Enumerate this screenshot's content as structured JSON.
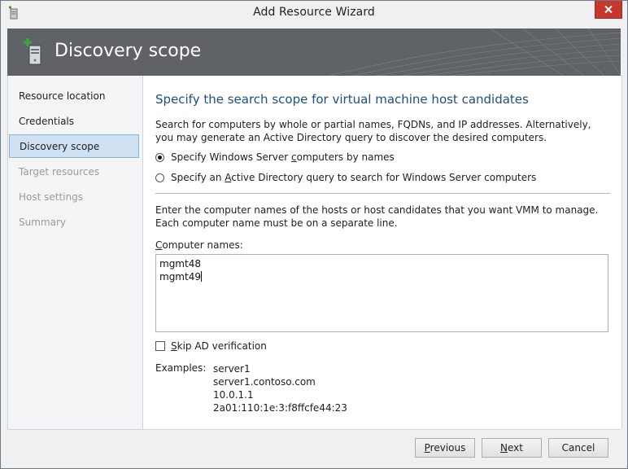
{
  "window": {
    "title": "Add Resource Wizard"
  },
  "banner": {
    "title": "Discovery scope"
  },
  "nav": {
    "items": [
      {
        "label": "Resource location",
        "state": "enabled"
      },
      {
        "label": "Credentials",
        "state": "enabled"
      },
      {
        "label": "Discovery scope",
        "state": "selected"
      },
      {
        "label": "Target resources",
        "state": "disabled"
      },
      {
        "label": "Host settings",
        "state": "disabled"
      },
      {
        "label": "Summary",
        "state": "disabled"
      }
    ]
  },
  "main": {
    "heading": "Specify the search scope for virtual machine host candidates",
    "description": "Search for computers by whole or partial names, FQDNs, and IP addresses. Alternatively, you may generate an Active Directory query to discover the desired computers.",
    "options": [
      {
        "label_pre": "Specify Windows Server ",
        "label_key": "c",
        "label_post": "omputers by names",
        "checked": true
      },
      {
        "label_pre": "Specify an ",
        "label_key": "A",
        "label_post": "ctive Directory query to search for Windows Server computers",
        "checked": false
      }
    ],
    "names_description": "Enter the computer names of the hosts or host candidates that you want VMM to manage. Each computer name must be on a separate line.",
    "computer_names_label_key": "C",
    "computer_names_label_rest": "omputer names:",
    "computer_names": [
      "mgmt48",
      "mgmt49"
    ],
    "skip_ad_key": "S",
    "skip_ad_rest": "kip AD verification",
    "skip_ad_checked": false,
    "examples_label": "Examples:",
    "examples": [
      "server1",
      "server1.contoso.com",
      "10.0.1.1",
      "2a01:110:1e:3:f8ffcfe44:23"
    ]
  },
  "footer": {
    "previous_key": "P",
    "previous_rest": "revious",
    "next_key": "N",
    "next_rest": "ext",
    "cancel": "Cancel"
  },
  "colors": {
    "banner_bg": "#5f6266",
    "heading": "#1e4f84",
    "selected_nav": "#cfe0f3",
    "close_button": "#c7372c"
  }
}
